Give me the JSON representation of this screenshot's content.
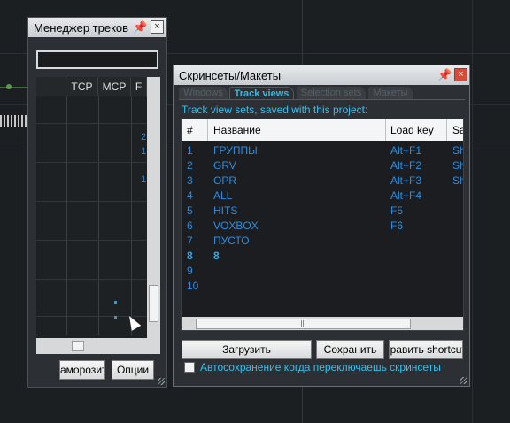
{
  "track_manager": {
    "title": "Менеджер треков",
    "search_value": "",
    "columns": [
      "TCP",
      "MCP",
      "F"
    ],
    "digits": [
      "2",
      "1",
      "1"
    ],
    "buttons": {
      "freeze": "аморозит",
      "options": "Опции"
    }
  },
  "screensets": {
    "title": "Скринсеты/Макеты",
    "tabs": [
      "Windows",
      "Track views",
      "Selection sets",
      "Макеты"
    ],
    "active_tab": "Track views",
    "caption": "Track view sets, saved with this project:",
    "columns": {
      "num": "#",
      "name": "Название",
      "key": "Load key",
      "save": "Sa"
    },
    "rows": [
      {
        "num": "1",
        "name": "ГРУППЫ",
        "key": "Alt+F1",
        "save": "Sh"
      },
      {
        "num": "2",
        "name": "GRV",
        "key": "Alt+F2",
        "save": "Sh"
      },
      {
        "num": "3",
        "name": "OPR",
        "key": "Alt+F3",
        "save": "Sh"
      },
      {
        "num": "4",
        "name": "ALL",
        "key": "Alt+F4",
        "save": ""
      },
      {
        "num": "5",
        "name": "HITS",
        "key": "F5",
        "save": ""
      },
      {
        "num": "6",
        "name": "VOXBOX",
        "key": "F6",
        "save": ""
      },
      {
        "num": "7",
        "name": "ПУСТО",
        "key": "",
        "save": ""
      },
      {
        "num": "8",
        "name": "8",
        "key": "",
        "save": ""
      },
      {
        "num": "9",
        "name": "",
        "key": "",
        "save": ""
      },
      {
        "num": "10",
        "name": "",
        "key": "",
        "save": ""
      }
    ],
    "buttons": {
      "load": "Загрузить",
      "save": "Сохранить",
      "edit_shortcuts": "Править shortcuts"
    },
    "autosave_label": "Автосохранение когда переключаешь скринсеты",
    "autosave_checked": false
  },
  "colors": {
    "accent_cyan": "#33c0f0",
    "row_text": "#2a8de0",
    "bold_text": "#2ea8e8"
  }
}
